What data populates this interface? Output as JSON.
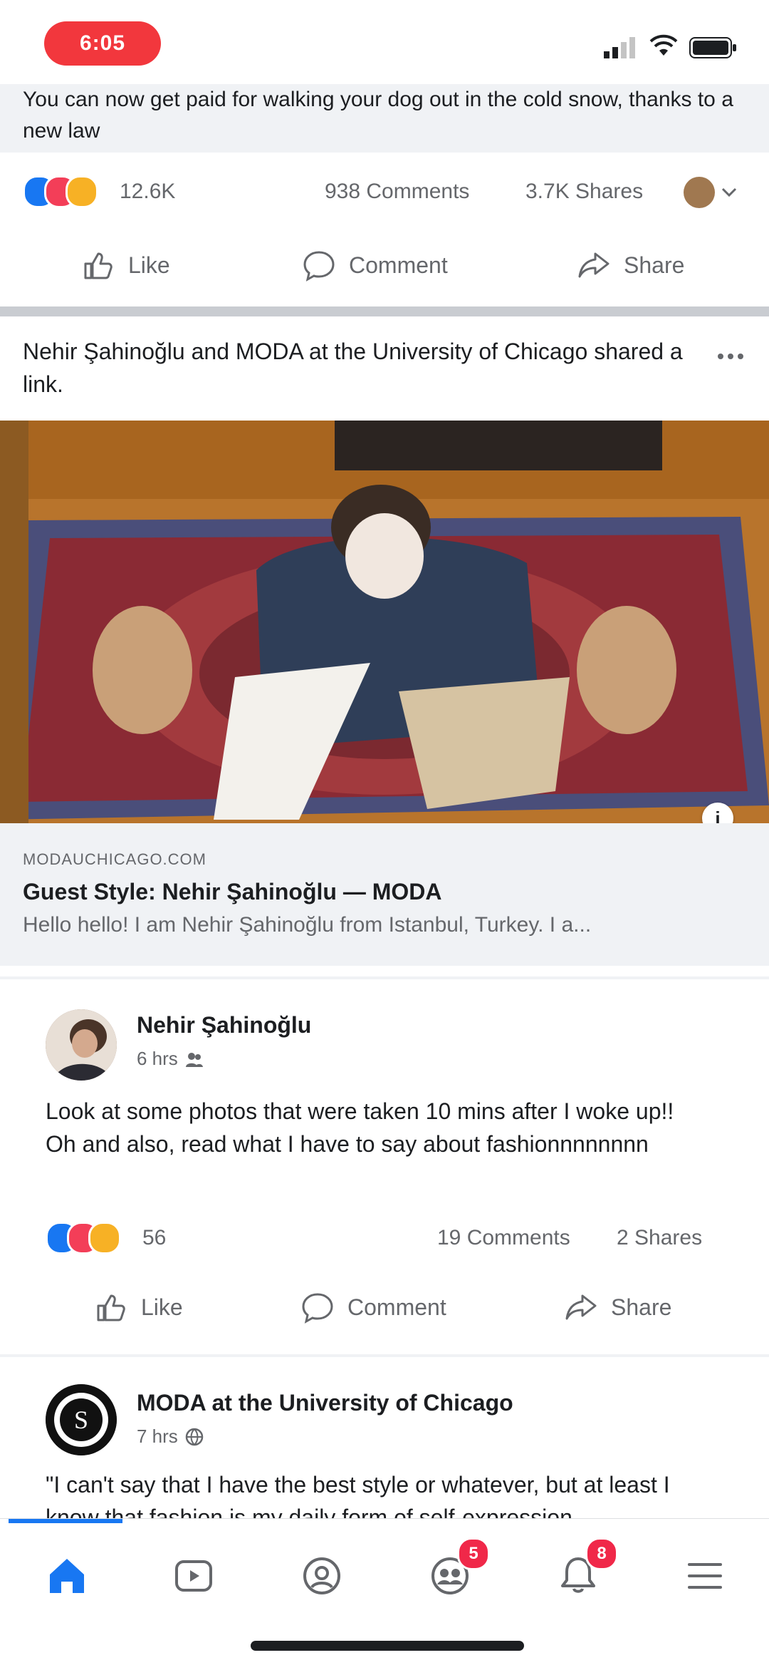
{
  "status_bar": {
    "time": "6:05"
  },
  "top_post": {
    "caption": "You can now get paid for walking your dog out in the cold snow, thanks to a new law",
    "reaction_count": "12.6K",
    "comments": "938 Comments",
    "shares": "3.7K Shares"
  },
  "actions": {
    "like": "Like",
    "comment": "Comment",
    "share": "Share"
  },
  "link_post": {
    "header": "Nehir Şahinoğlu and MODA at the University of Chicago shared a link.",
    "link_domain": "MODAUCHICAGO.COM",
    "link_title": "Guest Style: Nehir Şahinoğlu — MODA",
    "link_desc": "Hello hello! I am Nehir Şahinoğlu from Istanbul, Turkey. I a..."
  },
  "shared_post_1": {
    "author": "Nehir Şahinoğlu",
    "meta": "6 hrs",
    "body": "Look at some photos that were taken 10 mins after I woke up!! Oh and also, read what I have to say about fashionnnnnnnn",
    "reaction_count": "56",
    "comments": "19 Comments",
    "shares": "2 Shares"
  },
  "shared_post_2": {
    "author": "MODA at the University of Chicago",
    "meta": "7 hrs",
    "body": "\"I can't say that I have the best style or whatever, but at least I know that fashion is my daily form of self-expression..."
  },
  "bottom_nav": {
    "watch_badge": "",
    "groups_badge": "5",
    "notifications_badge": "8"
  },
  "colors": {
    "accent": "#1877f2",
    "badge": "#f02849"
  }
}
